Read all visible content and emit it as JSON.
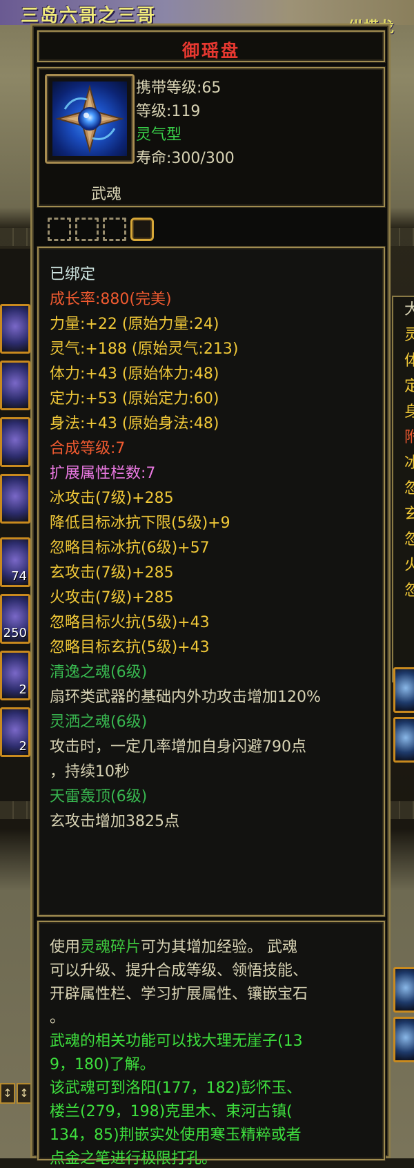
{
  "background": {
    "top_left_name": "三岛六哥之三哥",
    "top_right_name": "纵横龙",
    "side_slot_counts": [
      "74",
      "250",
      "2",
      "2"
    ],
    "right_panel_chars": [
      "大",
      "灵",
      "体",
      "定",
      "身",
      "附",
      "冰",
      "忽",
      "玄",
      "忽",
      "火",
      "忽"
    ]
  },
  "tooltip": {
    "item_name": "御瑶盘",
    "header": {
      "carry_level": "携带等级:65",
      "level": "等级:119",
      "type": "灵气型",
      "lifespan": "寿命:300/300"
    },
    "soul_label": "武魂",
    "sockets": [
      false,
      false,
      false,
      true
    ],
    "attributes": [
      {
        "text": "已绑定",
        "color": "cyan"
      },
      {
        "text": "成长率:880(完美)",
        "color": "red"
      },
      {
        "text": "力量:+22 (原始力量:24)",
        "color": "gold"
      },
      {
        "text": "灵气:+188 (原始灵气:213)",
        "color": "gold"
      },
      {
        "text": "体力:+43 (原始体力:48)",
        "color": "gold"
      },
      {
        "text": "定力:+53 (原始定力:60)",
        "color": "gold"
      },
      {
        "text": "身法:+43 (原始身法:48)",
        "color": "gold"
      },
      {
        "text": "合成等级:7",
        "color": "red"
      },
      {
        "text": "扩展属性栏数:7",
        "color": "pink"
      },
      {
        "text": "冰攻击(7级)+285",
        "color": "gold"
      },
      {
        "text": "降低目标冰抗下限(5级)+9",
        "color": "gold"
      },
      {
        "text": "忽略目标冰抗(6级)+57",
        "color": "gold"
      },
      {
        "text": "玄攻击(7级)+285",
        "color": "gold"
      },
      {
        "text": "火攻击(7级)+285",
        "color": "gold"
      },
      {
        "text": "忽略目标火抗(5级)+43",
        "color": "gold"
      },
      {
        "text": "忽略目标玄抗(5级)+43",
        "color": "gold"
      },
      {
        "text": "清逸之魂(6级)",
        "color": "green"
      },
      {
        "text": "扇环类武器的基础内外功攻击增加120%",
        "color": "white"
      },
      {
        "text": "灵洒之魂(6级)",
        "color": "green"
      },
      {
        "text": "攻击时，一定几率增加自身闪避790点",
        "color": "white"
      },
      {
        "text": "，持续10秒",
        "color": "white"
      },
      {
        "text": "天雷轰顶(6级)",
        "color": "green"
      },
      {
        "text": "玄攻击增加3825点",
        "color": "white"
      }
    ],
    "description": {
      "line1_pre": "使用",
      "line1_link": "灵魂碎片",
      "line1_post": "可为其增加经验。 武魂",
      "white_lines": [
        "可以升级、提升合成等级、领悟技能、",
        "开辟属性栏、学习扩展属性、镶嵌宝石",
        "。"
      ],
      "green_lines": [
        "武魂的相关功能可以找大理无崖子(13",
        "9，180)了解。",
        "该武魂可到洛阳(177，182)彭怀玉、",
        "楼兰(279，198)克里木、束河古镇(",
        "134，85)荆嵌实处使用寒玉精粹或者",
        "点金之笔进行极限打孔。"
      ]
    }
  },
  "colors": {
    "frame_gold": "#a08c50",
    "title_red": "#e83830",
    "attr_gold": "#f0c838",
    "attr_green": "#38b850",
    "desc_green": "#3ee03e"
  }
}
